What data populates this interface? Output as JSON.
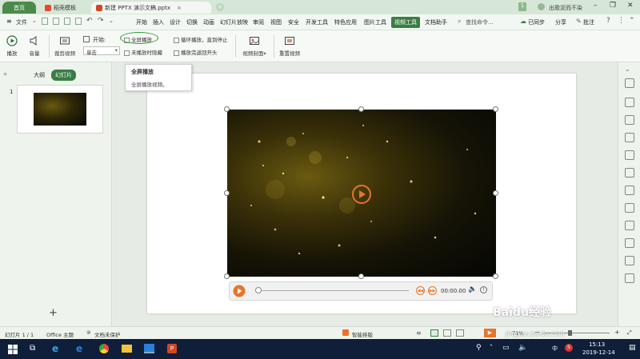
{
  "titlebar": {
    "tab_home": "首页",
    "tab_template": "稻壳模板",
    "tab_doc": "新建 PPTX 演示文稿.pptx",
    "page_badge": "1",
    "account": "出歌泥而不染"
  },
  "menubar": {
    "file": "文件",
    "items": [
      "开始",
      "插入",
      "设计",
      "切换",
      "动画",
      "幻灯片放映",
      "审阅",
      "视图",
      "安全",
      "开发工具",
      "特色应用",
      "图片工具",
      "视频工具",
      "文档助手"
    ],
    "active_item": "视频工具",
    "search": "查找命令...",
    "sync": "已同步",
    "share": "分享",
    "comment": "批注"
  },
  "ribbon": {
    "play": "播放",
    "volume": "音量",
    "trim": "裁剪视频",
    "start_label": "开始:",
    "start_value": "单击",
    "fullscreen": "全屏播放",
    "hide_when_not_playing": "未播放时隐藏",
    "loop": "循环播放，直到停止",
    "rewind": "播放完返回开头",
    "cover": "视频封面",
    "reset": "重置视频"
  },
  "tooltip": {
    "title": "全屏播放",
    "body": "全屏播放视频。"
  },
  "leftpanel": {
    "tab_outline": "大纲",
    "tab_slides": "幻灯片",
    "slide_number": "1",
    "add_symbol": "+"
  },
  "player": {
    "time": "00:00.00"
  },
  "statusbar": {
    "slide_info": "幻灯片 1 / 1",
    "theme": "Office 主题",
    "protect": "文档未保护",
    "smart": "智能排版",
    "zoom": "71%"
  },
  "taskbar": {
    "ime": "中",
    "time": "15:13",
    "date": "2019-12-14"
  },
  "watermark": {
    "text": "Baidu经验",
    "url": "jingyan.baidu.com"
  },
  "colors": {
    "accent": "#3a7d44",
    "highlight_circle": "#2e9e2e",
    "play_orange": "#e8742a",
    "taskbar": "#0f1f3a"
  }
}
